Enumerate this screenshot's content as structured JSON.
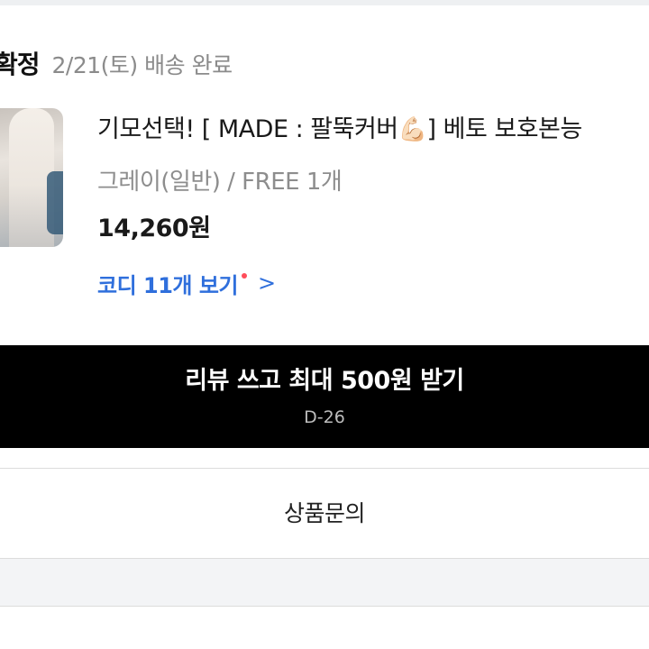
{
  "order": {
    "status_label": "확정",
    "delivery_date": "2/21(토) 배송 완료"
  },
  "product": {
    "thumbnail_icon": "product-photo",
    "name": "기모선택! [ MADE : 팔뚝커버",
    "name_emoji": "💪🏻",
    "name_suffix": "] 베토 보호본능",
    "option": "그레이(일반) / FREE 1개",
    "price": "14,260원",
    "codi_link": "코디 11개 보기",
    "codi_chevron": ">",
    "accent_color": "#2f6fdc",
    "new_dot_color": "#ff4d5a"
  },
  "review": {
    "title": "리뷰 쓰고 최대 500원 받기",
    "dday": "D-26",
    "background": "#000000"
  },
  "inquiry": {
    "label": "상품문의"
  }
}
